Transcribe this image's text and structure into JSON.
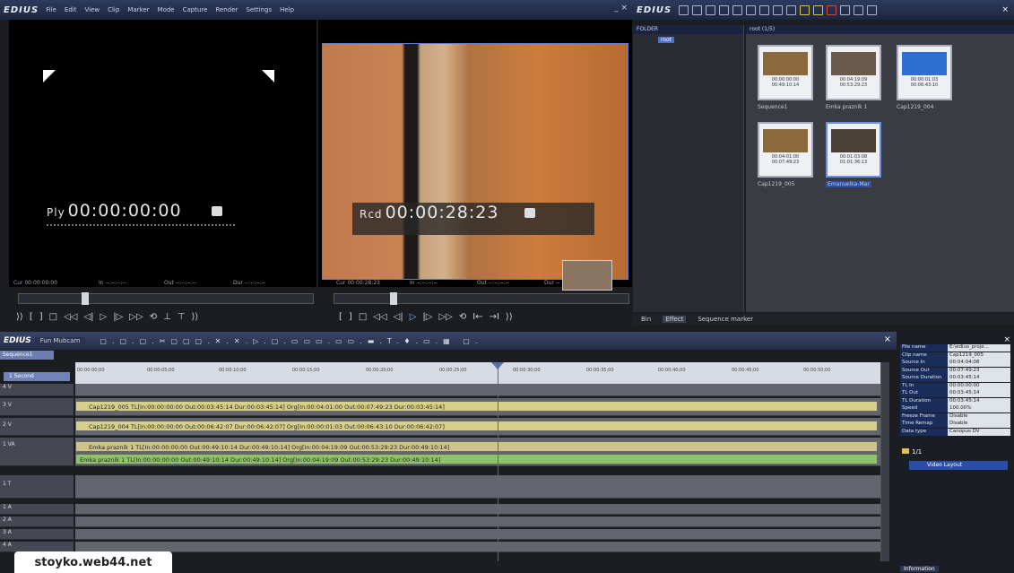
{
  "menubar": {
    "app": "EDIUS",
    "items": [
      "File",
      "Edit",
      "View",
      "Clip",
      "Marker",
      "Mode",
      "Capture",
      "Render",
      "Settings",
      "Help"
    ],
    "window_controls": "_ ×"
  },
  "binbar": {
    "app": "EDIUS",
    "close": "×"
  },
  "player": {
    "timecode_prefix": "Ply",
    "timecode": "00:00:00:00",
    "cur_label": "Cur 00:00:00:00",
    "in_label": "In --:--:--:--",
    "out_label": "Out --:--:--:--",
    "dur_label": "Dur --:--:--:--"
  },
  "recorder": {
    "timecode_prefix": "Rcd",
    "timecode": "00:00:28:23",
    "cur_label": "Cur 00:00:28:23",
    "in_label": "In --:--:--:--",
    "out_label": "Out --:--:--:--",
    "dur_label": "Dur --"
  },
  "folder": {
    "header": "FOLDER",
    "root": "root"
  },
  "bin": {
    "header": "root (1/5)",
    "clips": [
      {
        "name": "Sequence1",
        "tc1": "00:00:00:00",
        "tc2": "00:49:10:14",
        "color": "#8a6a3a"
      },
      {
        "name": "Emka prazník 1",
        "tc1": "00:04:19:09",
        "tc2": "00:53:29:23",
        "color": "#6b5a4c"
      },
      {
        "name": "Cap1219_004",
        "tc1": "00:00:01:03",
        "tc2": "00:06:43:10",
        "color": "#2c6fd1"
      },
      {
        "name": "Cap1219_005",
        "tc1": "00:04:01:00",
        "tc2": "00:07:49:23",
        "color": "#8a6a3a"
      },
      {
        "name": "Emanuelka-Mar",
        "tc1": "00:01:03:08",
        "tc2": "01:01:36:13",
        "color": "#4a4034"
      }
    ]
  },
  "bin_tabs": [
    "Bin",
    "Effect",
    "Sequence marker"
  ],
  "timeline": {
    "logo": "EDIUS",
    "project": "Fun Mubcam",
    "sequence_tab": "Sequence1",
    "scale": "1 Second",
    "ruler": [
      "00:00:00;00",
      "00:00:05;00",
      "00:00:10;00",
      "00:00:15;00",
      "00:00:20;00",
      "00:00:25;00",
      "00:00:30;00",
      "00:00:35;00",
      "00:00:40;00",
      "00:00:45;00",
      "00:00:50;00"
    ],
    "tracks": [
      {
        "label": "4 V",
        "body": "#5f626b"
      },
      {
        "label": "3 V",
        "body": "#5f626b"
      },
      {
        "label": "2 V",
        "body": "#5f626b"
      },
      {
        "label": "1 VA",
        "body": "#5f626b"
      },
      {
        "label": "1 T",
        "body": "#5f626b"
      },
      {
        "label": "1 A",
        "body": "#5f626b"
      },
      {
        "label": "2 A",
        "body": "#5f626b"
      },
      {
        "label": "3 A",
        "body": "#5f626b"
      },
      {
        "label": "4 A",
        "body": "#5f626b"
      }
    ],
    "clips": [
      {
        "text": "Cap1219_005  TL[In:00:00:00:00 Out:00:03:45:14 Dur:00:03:45:14]  Org[In:00:04:01:00 Out:00:07:49:23 Dur:00:03:45:14]",
        "color": "#d8cf8a"
      },
      {
        "text": "Cap1219_004  TL[In:00:00:00:00 Out:00:06:42:07 Dur:00:06:42:07]  Org[In:00:00:01:03 Out:00:06:43:10 Dur:00:06:42:07]",
        "color": "#d8cf8a"
      },
      {
        "text": "Emka prazník 1  TL[In:00:00:00:00 Out:00:49:10:14 Dur:00:49:10:14]  Org[In:00:04:19:09 Out:00:53:29:23 Dur:00:49:10:14]",
        "color": "#cfc48a"
      },
      {
        "text": "Emka prazník 1  TL[In:00:00:00:00 Out:00:49:10:14 Dur:00:49:10:14]  Org[In:00:04:19:09 Out:00:53:29:23 Dur:00:49:10:14]",
        "color": "#8fc36a"
      }
    ]
  },
  "info": {
    "rows": [
      {
        "k": "File name",
        "v": "E:\\edius_proje..."
      },
      {
        "k": "Clip name",
        "v": "Cap1219_005"
      },
      {
        "k": "Source In",
        "v": "00:04:04:08"
      },
      {
        "k": "Source Out",
        "v": "00:07:49:23"
      },
      {
        "k": "Source Duration",
        "v": "00:03:45:14"
      },
      {
        "k": "TL In",
        "v": "00:00:00:00"
      },
      {
        "k": "TL Out",
        "v": "00:03:45:14"
      },
      {
        "k": "TL Duration",
        "v": "00:03:45:14"
      },
      {
        "k": "Speed",
        "v": "100.00%"
      },
      {
        "k": "Freeze Frame",
        "v": "Disable"
      },
      {
        "k": "Time Remap",
        "v": "Disable"
      },
      {
        "k": "Data type",
        "v": "Canopus DV"
      }
    ],
    "page": "1/1",
    "layout_item": "Video Layout",
    "tab": "Information"
  },
  "watermark": "stoyko.web44.net"
}
